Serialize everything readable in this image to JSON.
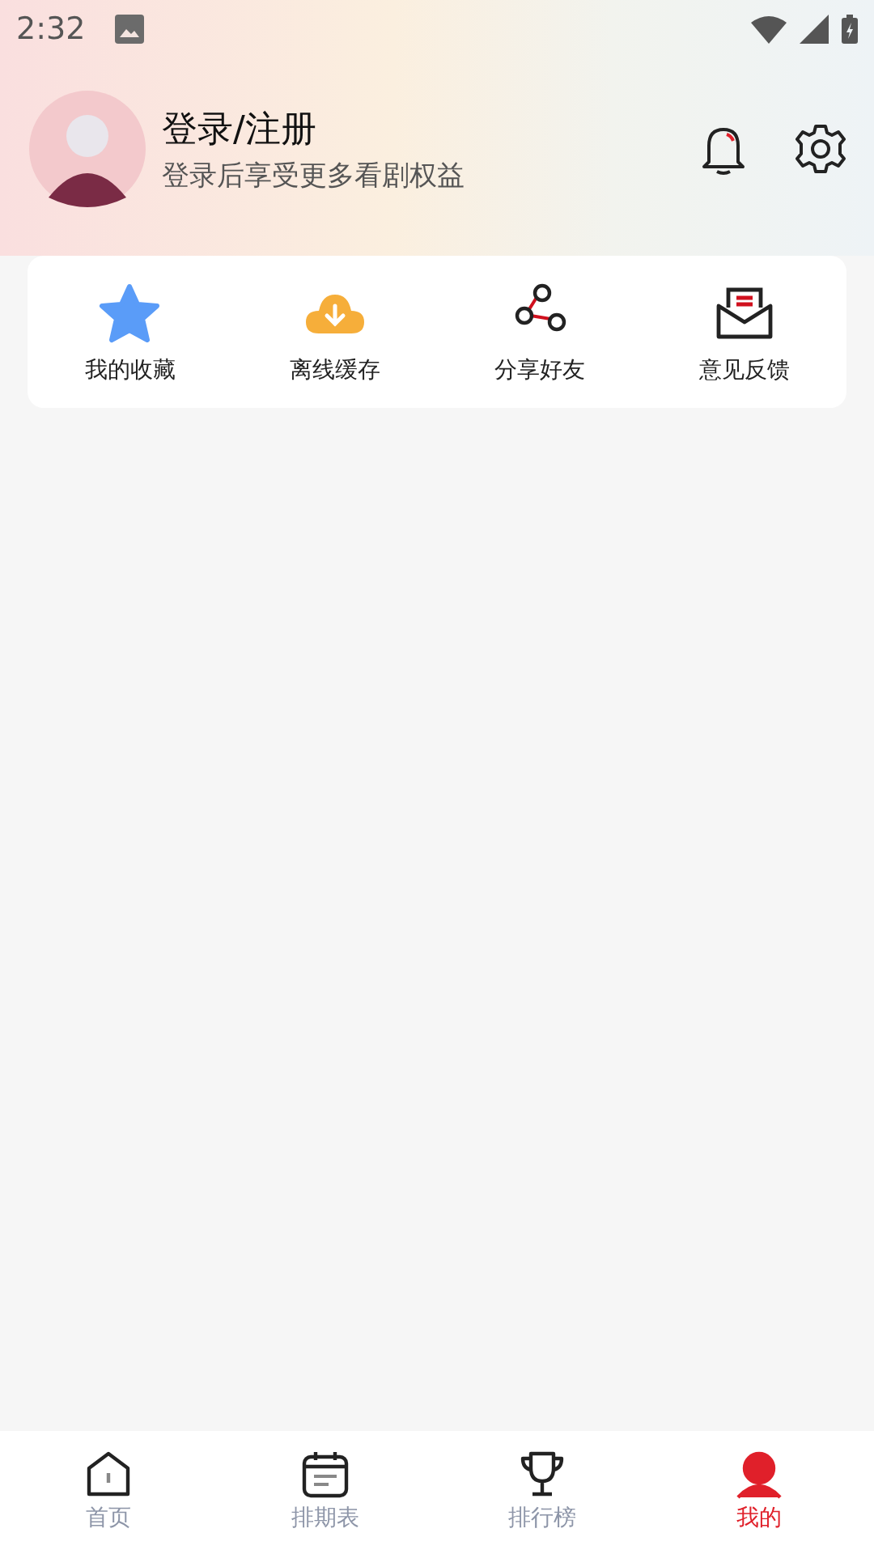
{
  "status_bar": {
    "time": "2:32"
  },
  "profile": {
    "title": "登录/注册",
    "subtitle": "登录后享受更多看剧权益"
  },
  "shortcuts": [
    {
      "kind": "star",
      "label": "我的收藏"
    },
    {
      "kind": "download",
      "label": "离线缓存"
    },
    {
      "kind": "share",
      "label": "分享好友"
    },
    {
      "kind": "feedback",
      "label": "意见反馈"
    }
  ],
  "bottom_nav": [
    {
      "kind": "home",
      "label": "首页",
      "selected": false
    },
    {
      "kind": "calendar",
      "label": "排期表",
      "selected": false
    },
    {
      "kind": "trophy",
      "label": "排行榜",
      "selected": false
    },
    {
      "kind": "me",
      "label": "我的",
      "selected": true
    }
  ]
}
